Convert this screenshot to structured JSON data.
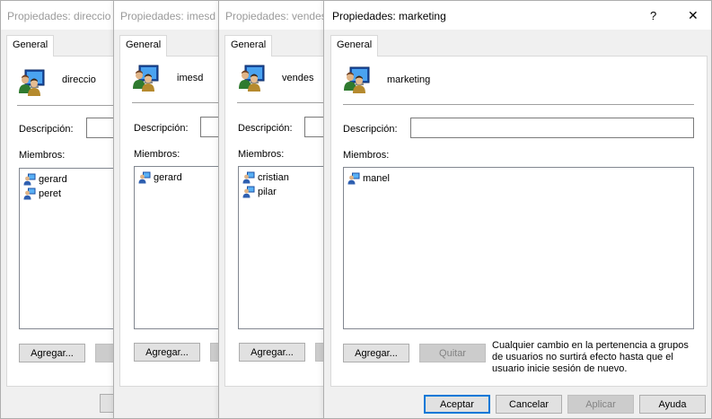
{
  "dialogs": [
    {
      "title": "Propiedades: direccio",
      "tab": "General",
      "group_name": "direccio",
      "description_label": "Descripción:",
      "members_label": "Miembros:",
      "members": [
        "gerard",
        "peret"
      ],
      "add_label": "Agregar..."
    },
    {
      "title": "Propiedades: imesd",
      "tab": "General",
      "group_name": "imesd",
      "description_label": "Descripción:",
      "members_label": "Miembros:",
      "members": [
        "gerard"
      ],
      "add_label": "Agregar..."
    },
    {
      "title": "Propiedades: vendes",
      "tab": "General",
      "group_name": "vendes",
      "description_label": "Descripción:",
      "members_label": "Miembros:",
      "members": [
        "cristian",
        "pilar"
      ],
      "add_label": "Agregar..."
    },
    {
      "title": "Propiedades: marketing",
      "tab": "General",
      "group_name": "marketing",
      "description_label": "Descripción:",
      "description_value": "",
      "members_label": "Miembros:",
      "members": [
        "manel"
      ],
      "add_label": "Agregar...",
      "remove_label": "Quitar",
      "note": "Cualquier cambio en la pertenencia a grupos de usuarios no surtirá efecto hasta que el usuario inicie sesión de nuevo.",
      "help_glyph": "?",
      "close_glyph": "✕",
      "buttons": {
        "ok": "Aceptar",
        "cancel": "Cancelar",
        "apply": "Aplicar",
        "help": "Ayuda"
      }
    }
  ],
  "icons": {
    "group": "group-icon",
    "user": "user-icon",
    "help": "help-icon",
    "close": "close-icon"
  },
  "colors": {
    "dialog_bg": "#f0f0f0",
    "default_button_border": "#0078d7",
    "disabled_text": "#838383"
  }
}
